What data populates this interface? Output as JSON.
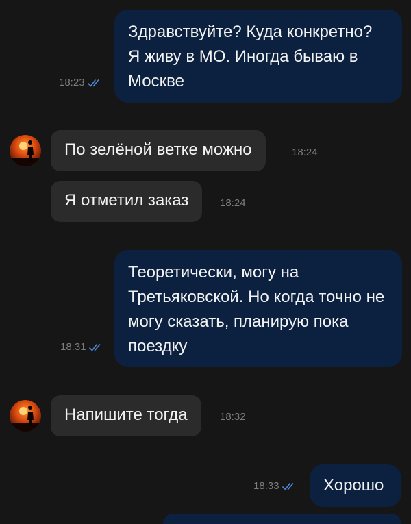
{
  "messages": [
    {
      "direction": "outgoing",
      "text": "Здравствуйте? Куда конкретно? Я живу в МО. Иногда бываю в Москве",
      "time": "18:23",
      "status": "read"
    },
    {
      "direction": "incoming",
      "text": "По зелёной ветке можно",
      "time": "18:24"
    },
    {
      "direction": "incoming",
      "text": "Я отметил заказ",
      "time": "18:24"
    },
    {
      "direction": "outgoing",
      "text": "Теоретически, могу на Третьяковской. Но когда точно не могу сказать, планирую пока поездку",
      "time": "18:31",
      "status": "read"
    },
    {
      "direction": "incoming",
      "text": "Напишите тогда",
      "time": "18:32"
    },
    {
      "direction": "outgoing",
      "text": "Хорошо",
      "time": "18:33",
      "status": "read"
    }
  ],
  "colors": {
    "background": "#161616",
    "outgoing_bubble": "#0c2140",
    "incoming_bubble": "#2b2b2b",
    "read_checks": "#4f86d6",
    "time_text": "#7d7d7d"
  },
  "icons": {
    "read_status": "double-check-icon",
    "sender_avatar": "sunset-silhouette-avatar"
  }
}
